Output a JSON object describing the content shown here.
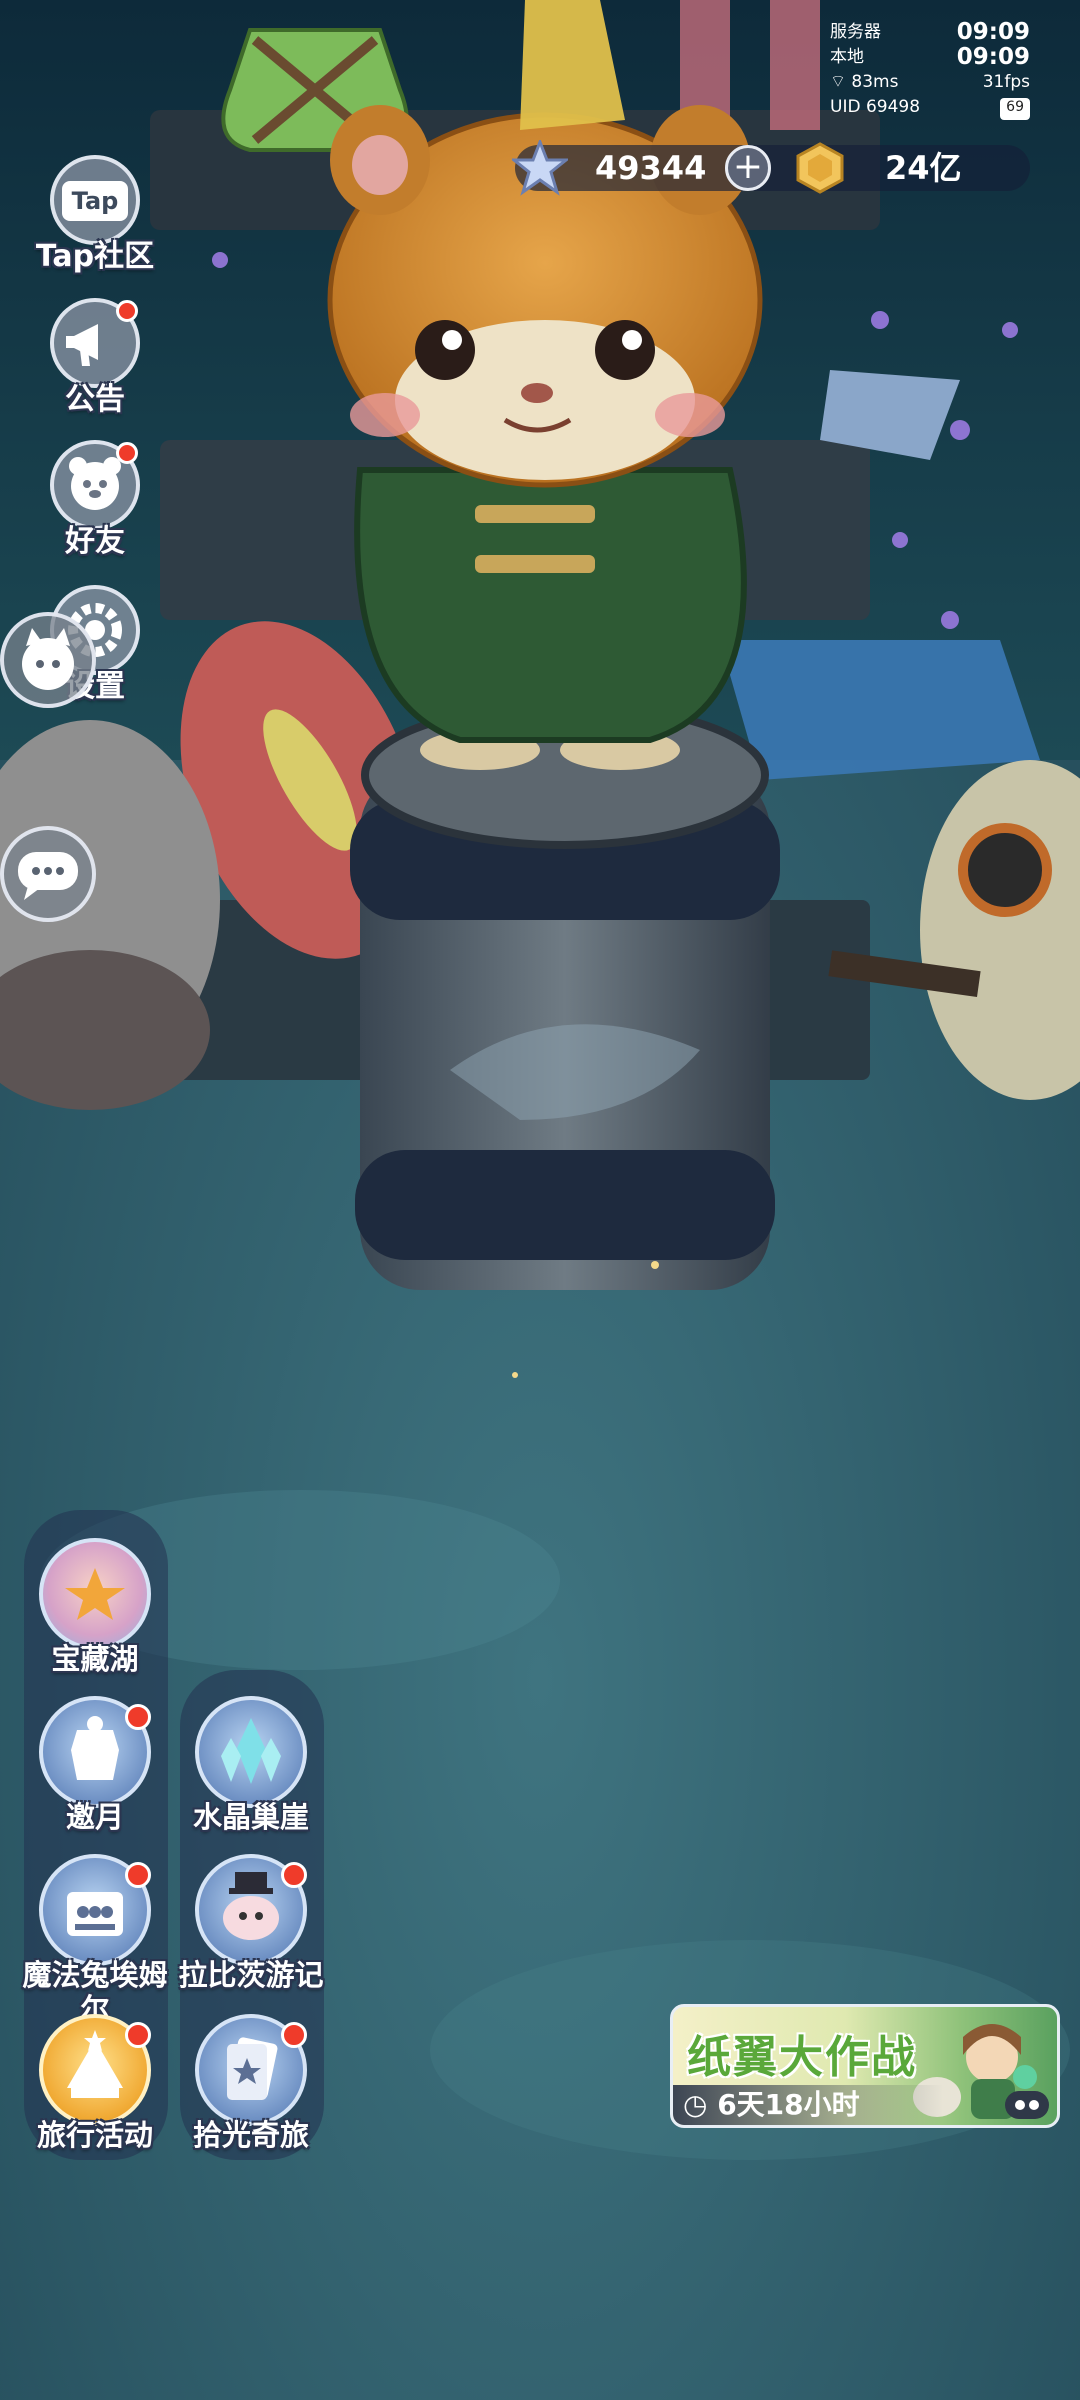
{
  "status": {
    "server_label": "服务器",
    "server_time": "09:09",
    "local_label": "本地",
    "local_time": "09:09",
    "ping": "83ms",
    "fps": "31fps",
    "uid": "UID 69498",
    "battery": "69"
  },
  "currency": {
    "stars": "49344",
    "coins": "24亿"
  },
  "left_menu": [
    {
      "label": "Tap社区",
      "icon": "tap-community-icon"
    },
    {
      "label": "公告",
      "icon": "megaphone-icon"
    },
    {
      "label": "好友",
      "icon": "friends-icon"
    },
    {
      "label": "设置",
      "icon": "gear-icon"
    }
  ],
  "activities": {
    "col1": [
      {
        "label": "宝藏湖",
        "icon": "treasure-lake-icon"
      },
      {
        "label": "邀月",
        "icon": "invite-moon-icon"
      },
      {
        "label": "魔法兔埃姆尔",
        "icon": "magic-rabbit-icon"
      },
      {
        "label": "旅行活动",
        "icon": "travel-event-icon"
      }
    ],
    "col2": [
      {
        "label": "水晶巢崖",
        "icon": "crystal-cliff-icon"
      },
      {
        "label": "拉比茨游记",
        "icon": "rabbit-travel-icon"
      },
      {
        "label": "拾光奇旅",
        "icon": "card-journey-icon"
      }
    ]
  },
  "event_banner": {
    "title": "纸翼大作战",
    "timer": "6天18小时"
  },
  "colors": {
    "notification": "#ef3b2a",
    "panel": "#233250",
    "banner_green": "#5aa83a"
  }
}
